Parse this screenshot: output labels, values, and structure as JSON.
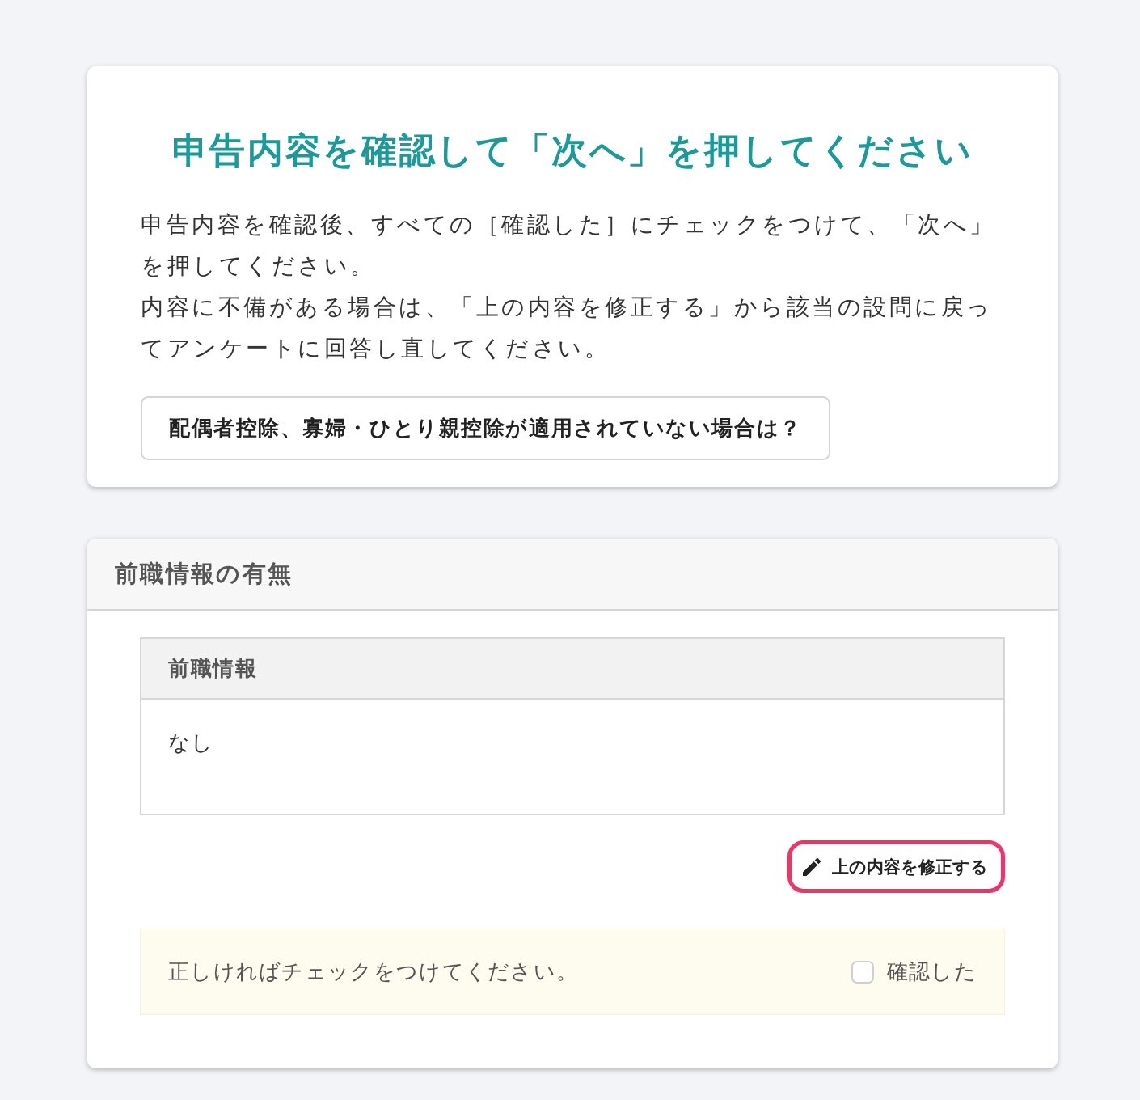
{
  "instructions": {
    "title": "申告内容を確認して「次へ」を押してください",
    "paragraphs": [
      "申告内容を確認後、すべての［確認した］にチェックをつけて、「次へ」を押してください。",
      "内容に不備がある場合は、「上の内容を修正する」から該当の設問に戻ってアンケートに回答し直してください。"
    ],
    "help_button": "配偶者控除、寡婦・ひとり親控除が適用されていない場合は？"
  },
  "sections": [
    {
      "heading": "前職情報の有無",
      "table": {
        "header": "前職情報",
        "value": "なし"
      },
      "edit_button": {
        "label": "上の内容を修正する",
        "highlighted": true
      },
      "confirm": {
        "prompt": "正しければチェックをつけてください。",
        "checkbox_label": "確認した",
        "checked": false
      }
    }
  ]
}
